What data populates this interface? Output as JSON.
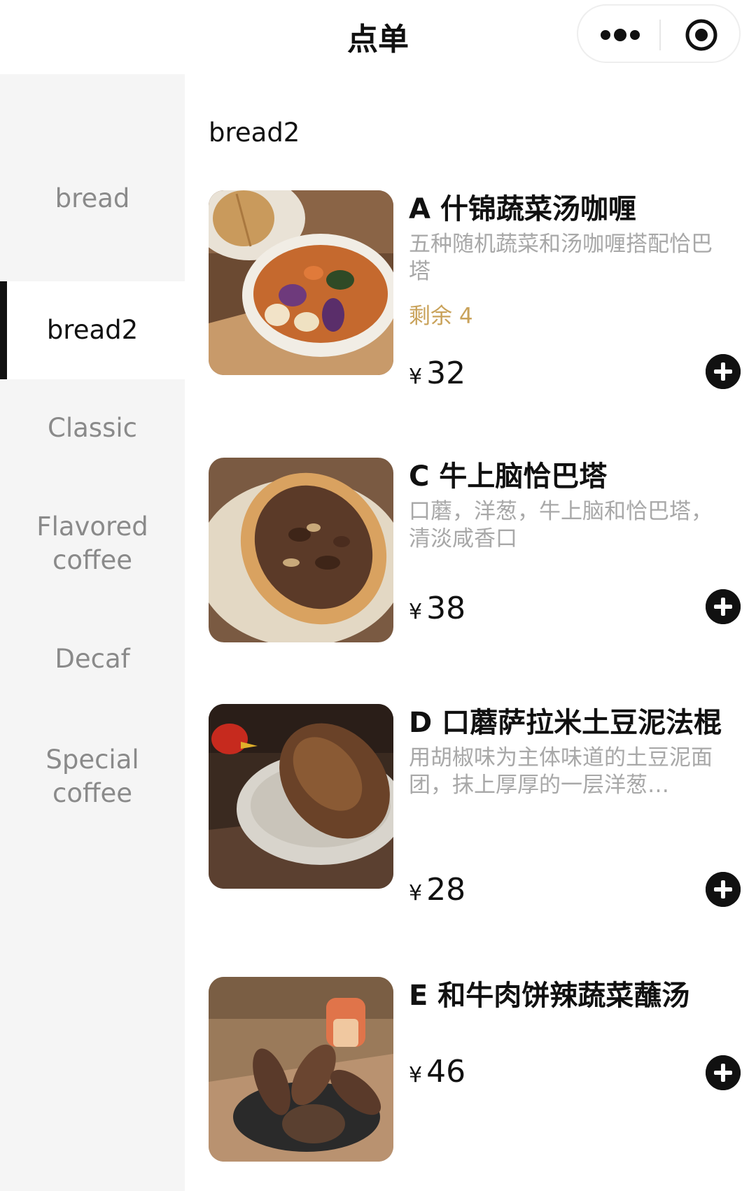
{
  "header": {
    "title": "点单"
  },
  "sidebar": {
    "items": [
      {
        "label": "bread"
      },
      {
        "label": "bread2"
      },
      {
        "label": "Classic"
      },
      {
        "label": "Flavored coffee"
      },
      {
        "label": "Decaf"
      },
      {
        "label": "Special coffee"
      }
    ],
    "active_index": 1
  },
  "section": {
    "title": "bread2"
  },
  "products": [
    {
      "name": "A 什锦蔬菜汤咖喱",
      "desc": "五种随机蔬菜和汤咖喱搭配恰巴塔",
      "stock": "剩余 4",
      "currency": "¥",
      "price": "32",
      "image": "vegetable-curry-photo"
    },
    {
      "name": "C 牛上脑恰巴塔",
      "desc": "口蘑，洋葱，牛上脑和恰巴塔，清淡咸香口",
      "currency": "¥",
      "price": "38",
      "image": "beef-sandwich-photo"
    },
    {
      "name": "D 口蘑萨拉米土豆泥法棍",
      "desc": "用胡椒味为主体味道的土豆泥面团，抹上厚厚的一层洋葱…",
      "currency": "¥",
      "price": "28",
      "image": "baguette-photo"
    },
    {
      "name": "E 和牛肉饼辣蔬菜蘸汤",
      "currency": "¥",
      "price": "46",
      "image": "wagyu-patty-bread-photo"
    }
  ],
  "icons": {
    "more": "more-dots-icon",
    "close": "target-circle-icon",
    "add": "plus-circle-icon"
  },
  "colors": {
    "accent": "#111111",
    "stock": "#c9a25a",
    "sidebar_bg": "#f5f5f5",
    "muted_text": "#a8a8a8"
  }
}
